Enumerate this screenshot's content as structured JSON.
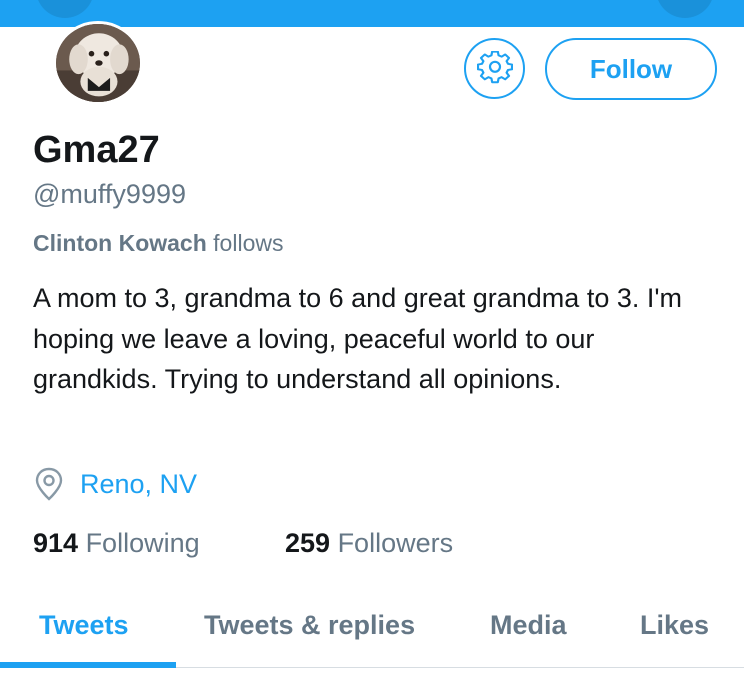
{
  "profile": {
    "display_name": "Gma27",
    "handle": "@muffy9999",
    "followed_by_name": "Clinton Kowach",
    "followed_by_suffix": " follows",
    "bio": "A mom to 3, grandma to 6 and great grandma to 3. I'm hoping we leave a loving, peaceful world to our grandkids. Trying to understand all opinions.",
    "location": "Reno, NV"
  },
  "actions": {
    "follow_label": "Follow",
    "settings_icon": "gear-icon"
  },
  "stats": {
    "following_count": "914",
    "following_label": " Following",
    "followers_count": "259",
    "followers_label": " Followers"
  },
  "tabs": [
    {
      "label": "Tweets",
      "active": true
    },
    {
      "label": "Tweets & replies",
      "active": false
    },
    {
      "label": "Media",
      "active": false
    },
    {
      "label": "Likes",
      "active": false
    }
  ],
  "colors": {
    "accent": "#1da1f2",
    "text_primary": "#14171a",
    "text_secondary": "#657786"
  }
}
